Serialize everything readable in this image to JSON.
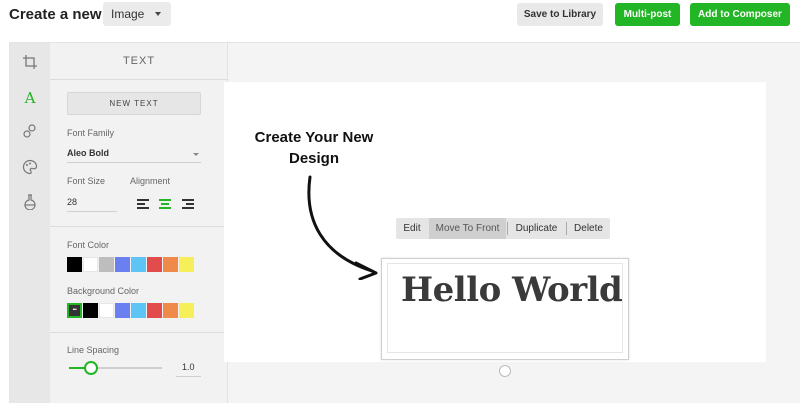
{
  "header": {
    "title": "Create a new",
    "type_select": "Image",
    "buttons": {
      "save_to_library": "Save to Library",
      "multi_post": "Multi-post",
      "add_to_composer": "Add to Composer"
    }
  },
  "rail": {
    "icons": [
      "crop-icon",
      "text-icon",
      "shapes-icon",
      "palette-icon",
      "filter-icon"
    ],
    "active": "text-icon"
  },
  "panel": {
    "title": "TEXT",
    "new_text_button": "NEW TEXT",
    "font_family_label": "Font Family",
    "font_family_value": "Aleo Bold",
    "font_size_label": "Font Size",
    "font_size_value": "28",
    "alignment_label": "Alignment",
    "alignment_options": [
      "left",
      "center",
      "right"
    ],
    "alignment_selected": "center",
    "font_color_label": "Font Color",
    "font_colors": [
      "#000000",
      "#ffffff",
      "#bdbdbd",
      "#6a80f0",
      "#5ec4f5",
      "#e34c4c",
      "#f08a4b",
      "#f7ef5a"
    ],
    "background_color_label": "Background Color",
    "background_colors": [
      "#333333",
      "#000000",
      "#ffffff",
      "#6a80f0",
      "#5ec4f5",
      "#e34c4c",
      "#f08a4b",
      "#f7ef5a"
    ],
    "background_selected_index": 0,
    "line_spacing_label": "Line Spacing",
    "line_spacing_value": "1.0",
    "line_spacing_fraction": 0.24
  },
  "canvas": {
    "annotation": "Create Your New Design",
    "context_menu": {
      "edit": "Edit",
      "move_to_front": "Move To Front",
      "duplicate": "Duplicate",
      "delete": "Delete"
    },
    "text_element": "Hello World"
  },
  "colors": {
    "accent": "#22b525"
  }
}
